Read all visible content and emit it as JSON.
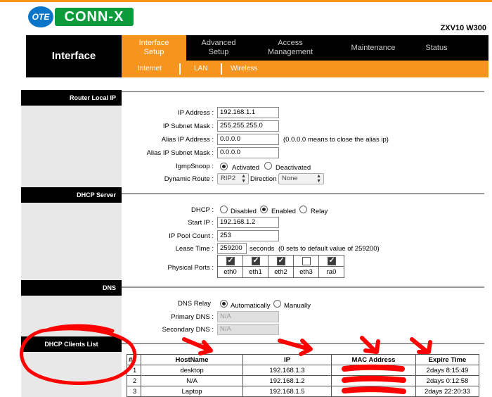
{
  "brand": {
    "logo_left": "OTE",
    "logo_right": "CONN-X",
    "model": "ZXV10 W300"
  },
  "nav": {
    "section_title": "Interface",
    "tabs": [
      {
        "label": "Interface Setup",
        "line1": "Interface",
        "line2": "Setup"
      },
      {
        "label": "Advanced Setup",
        "line1": "Advanced",
        "line2": "Setup"
      },
      {
        "label": "Access Management",
        "line1": "Access",
        "line2": "Management"
      },
      {
        "label": "Maintenance",
        "line1": "Maintenance",
        "line2": ""
      },
      {
        "label": "Status",
        "line1": "Status",
        "line2": ""
      }
    ],
    "subtabs": [
      "Internet",
      "LAN",
      "Wireless"
    ]
  },
  "router_local_ip": {
    "heading": "Router Local IP",
    "ip_address_label": "IP Address :",
    "ip_address": "192.168.1.1",
    "subnet_label": "IP Subnet Mask :",
    "subnet": "255.255.255.0",
    "alias_ip_label": "Alias IP Address :",
    "alias_ip": "0.0.0.0",
    "alias_ip_note": "(0.0.0.0 means to close the alias ip)",
    "alias_subnet_label": "Alias IP Subnet Mask :",
    "alias_subnet": "0.0.0.0",
    "igmp_label": "IgmpSnoop :",
    "igmp_options": [
      "Activated",
      "Deactivated"
    ],
    "igmp_selected": "Activated",
    "dynamic_route_label": "Dynamic Route :",
    "dynamic_route": "RIP2",
    "direction_label": "Direction",
    "direction": "None"
  },
  "dhcp_server": {
    "heading": "DHCP Server",
    "dhcp_label": "DHCP :",
    "dhcp_options": [
      "Disabled",
      "Enabled",
      "Relay"
    ],
    "dhcp_selected": "Enabled",
    "start_ip_label": "Start IP :",
    "start_ip": "192.168.1.2",
    "pool_label": "IP Pool Count :",
    "pool": "253",
    "lease_label": "Lease Time :",
    "lease": "259200",
    "lease_unit": "seconds",
    "lease_note": "(0 sets to default value of 259200)",
    "ports_label": "Physical Ports :",
    "ports": [
      {
        "name": "eth0",
        "checked": true
      },
      {
        "name": "eth1",
        "checked": true
      },
      {
        "name": "eth2",
        "checked": true
      },
      {
        "name": "eth3",
        "checked": false
      },
      {
        "name": "ra0",
        "checked": true
      }
    ]
  },
  "dns": {
    "heading": "DNS",
    "relay_label": "DNS Relay",
    "relay_options": [
      "Automatically",
      "Manually"
    ],
    "relay_selected": "Automatically",
    "primary_label": "Primary DNS :",
    "primary": "N/A",
    "secondary_label": "Secondary DNS :",
    "secondary": "N/A"
  },
  "dhcp_clients": {
    "heading": "DHCP Clients List",
    "columns": [
      "#",
      "HostName",
      "IP",
      "MAC Address",
      "Expire Time"
    ],
    "rows": [
      {
        "num": "1",
        "host": "desktop",
        "ip": "192.168.1.3",
        "mac": "",
        "expire": "2days 8:15:49"
      },
      {
        "num": "2",
        "host": "N/A",
        "ip": "192.168.1.2",
        "mac": "",
        "expire": "2days 0:12:58"
      },
      {
        "num": "3",
        "host": "Laptop",
        "ip": "192.168.1.5",
        "mac": "",
        "expire": "2days 22:20:33"
      }
    ]
  },
  "colors": {
    "accent": "#f7941d",
    "annotation": "#ff0000",
    "nav_bg": "#000000"
  }
}
